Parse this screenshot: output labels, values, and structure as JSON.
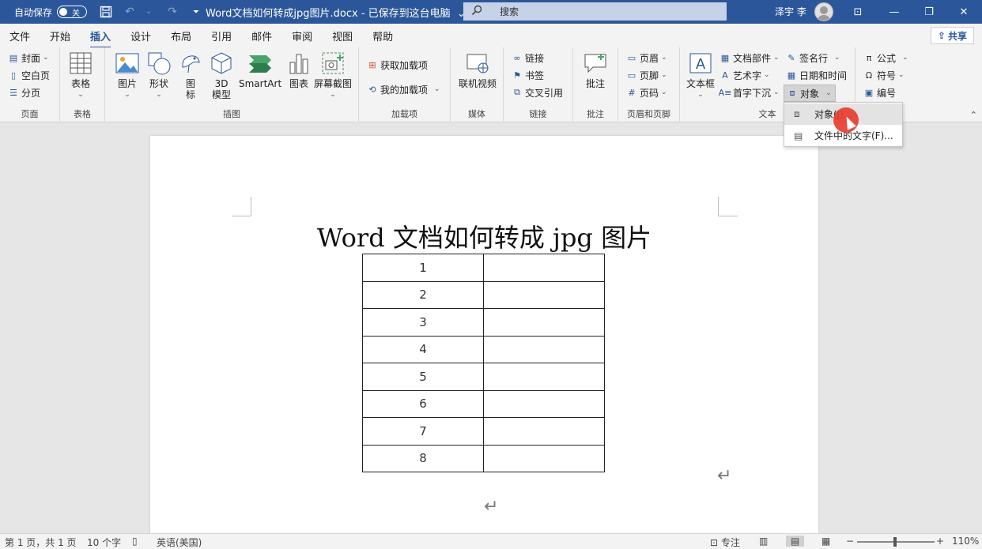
{
  "titlebar": {
    "autosave_label": "自动保存",
    "autosave_state": "关",
    "doc_title": "Word文档如何转成jpg图片.docx - 已保存到这台电脑",
    "title_caret": "⌄",
    "search_placeholder": "搜索",
    "user_name": "泽宇 李",
    "minimize": "—",
    "restore": "❐",
    "close": "✕",
    "ribbon_display": "⊡"
  },
  "tabs": [
    "文件",
    "开始",
    "插入",
    "设计",
    "布局",
    "引用",
    "邮件",
    "审阅",
    "视图",
    "帮助"
  ],
  "active_tab": "插入",
  "share_label": "共享",
  "ribbon": {
    "pages": {
      "label": "页面",
      "items": [
        "封面",
        "空白页",
        "分页"
      ]
    },
    "tables": {
      "label": "表格",
      "table_btn": "表格"
    },
    "illustrations": {
      "label": "插图",
      "picture": "图片",
      "shapes": "形状",
      "icons_1": "图",
      "icons_2": "标",
      "model_1": "3D",
      "model_2": "模型",
      "smartart": "SmartArt",
      "chart": "图表",
      "screenshot": "屏幕截图"
    },
    "addins": {
      "label": "加载项",
      "get": "获取加载项",
      "mine": "我的加载项"
    },
    "media": {
      "label": "媒体",
      "online_video": "联机视频"
    },
    "links": {
      "label": "链接",
      "link": "链接",
      "bookmark": "书签",
      "cross_ref": "交叉引用"
    },
    "comments": {
      "label": "批注",
      "comment": "批注"
    },
    "header_footer": {
      "label": "页眉和页脚",
      "header": "页眉",
      "footer": "页脚",
      "page_number": "页码"
    },
    "text": {
      "label": "文本",
      "textbox_1": "文本框",
      "quick_parts": "文档部件",
      "wordart": "艺术字",
      "dropcap": "首字下沉",
      "signature": "签名行",
      "datetime": "日期和时间",
      "object": "对象"
    },
    "symbols": {
      "equation": "公式",
      "symbol": "符号",
      "number": "编号"
    }
  },
  "dropdown": {
    "item_object": "对象(J)...",
    "item_text_from_file": "文件中的文字(F)..."
  },
  "document": {
    "heading": "Word 文档如何转成 jpg 图片",
    "rows": [
      "1",
      "2",
      "3",
      "4",
      "5",
      "6",
      "7",
      "8"
    ],
    "para_mark": "↵"
  },
  "statusbar": {
    "page": "第 1 页，共 1 页",
    "words": "10 个字",
    "language": "英语(美国)",
    "focus": "专注",
    "minus": "−",
    "plus": "+",
    "zoom": "110%"
  }
}
